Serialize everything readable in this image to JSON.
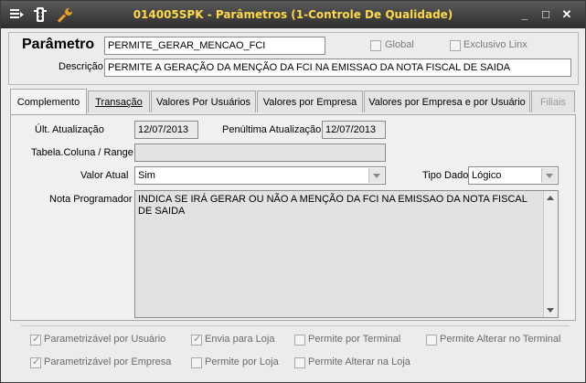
{
  "window": {
    "title": "014005SPK - Parâmetros (1-Controle De Qualidade)",
    "min": "_",
    "max": "□",
    "close": "✕"
  },
  "header": {
    "param_label": "Parâmetro",
    "param_value": "PERMITE_GERAR_MENCAO_FCI",
    "global_label": "Global",
    "exclusivo_label": "Exclusivo Linx",
    "desc_label": "Descrição",
    "desc_value": "PERMITE A GERAÇÃO DA MENÇÃO DA FCI NA EMISSAO DA NOTA FISCAL DE SAIDA"
  },
  "tabs": [
    {
      "label": "Complemento"
    },
    {
      "label": "Transação"
    },
    {
      "label": "Valores Por Usuários"
    },
    {
      "label": "Valores por Empresa"
    },
    {
      "label": "Valores por Empresa e por Usuário"
    },
    {
      "label": "Filiais"
    }
  ],
  "complemento": {
    "ult_label": "Últ. Atualização",
    "ult_value": "12/07/2013",
    "pen_label": "Penúltima Atualização",
    "pen_value": "12/07/2013",
    "tabela_label": "Tabela.Coluna / Range",
    "tabela_value": "",
    "valor_label": "Valor Atual",
    "valor_value": "Sim",
    "tipo_label": "Tipo Dado",
    "tipo_value": "Lógico",
    "nota_label": "Nota Programador",
    "nota_value": "INDICA SE IRÁ GERAR OU NÃO A MENÇÃO DA FCI NA EMISSAO DA NOTA FISCAL DE SAIDA"
  },
  "options": [
    {
      "label": "Parametrizável por Usuário",
      "checked": true
    },
    {
      "label": "Envia para Loja",
      "checked": true
    },
    {
      "label": "Permite por Terminal",
      "checked": false
    },
    {
      "label": "Permite Alterar no Terminal",
      "checked": false
    },
    {
      "label": "Parametrizável por Empresa",
      "checked": true
    },
    {
      "label": "Permite por Loja",
      "checked": false
    },
    {
      "label": "Permite Alterar na Loja",
      "checked": false
    }
  ],
  "colors": {
    "title_text": "#ffd94a",
    "titlebar": "#3a3a3a"
  },
  "icons": [
    "menu-icon",
    "traffic-light-icon",
    "wrench-icon"
  ]
}
